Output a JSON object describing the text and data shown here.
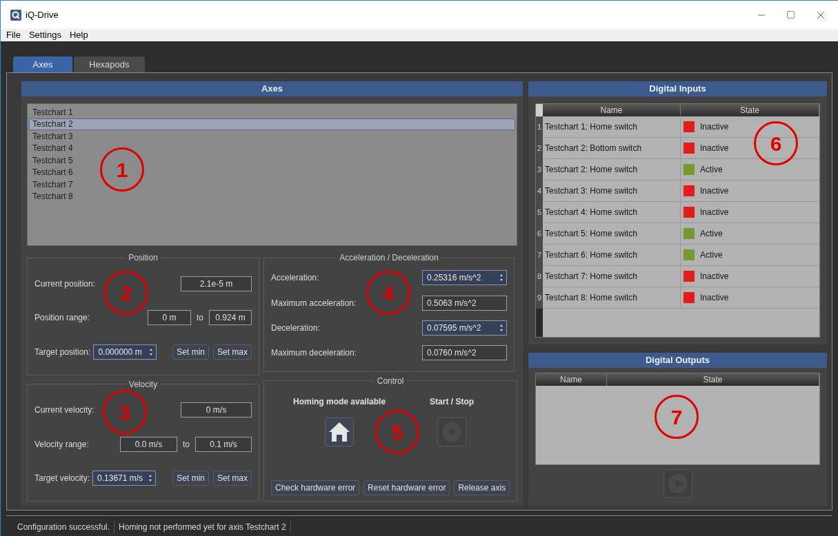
{
  "window": {
    "title": "iQ-Drive"
  },
  "menu": [
    "File",
    "Settings",
    "Help"
  ],
  "tabs": [
    {
      "label": "Axes",
      "selected": true
    },
    {
      "label": "Hexapods",
      "selected": false
    }
  ],
  "axes": {
    "title": "Axes",
    "items": [
      {
        "label": "Testchart 1",
        "selected": false
      },
      {
        "label": "Testchart 2",
        "selected": true
      },
      {
        "label": "Testchart 3",
        "selected": false
      },
      {
        "label": "Testchart 4",
        "selected": false
      },
      {
        "label": "Testchart 5",
        "selected": false
      },
      {
        "label": "Testchart 6",
        "selected": false
      },
      {
        "label": "Testchart 7",
        "selected": false
      },
      {
        "label": "Testchart 8",
        "selected": false
      }
    ]
  },
  "position": {
    "title": "Position",
    "current_label": "Current position:",
    "current": "2.1e-5 m",
    "range_label": "Position range:",
    "range_min": "0 m",
    "range_sep": "to",
    "range_max": "0.924 m",
    "target_label": "Target position:",
    "target": "0.000000 m",
    "buttons": [
      "Set min",
      "Set max"
    ]
  },
  "velocity": {
    "title": "Velocity",
    "current_label": "Current velocity:",
    "current": "0 m/s",
    "range_label": "Velocity range:",
    "range_min": "0.0 m/s",
    "range_sep": "to",
    "range_max": "0.1 m/s",
    "target_label": "Target velocity:",
    "target": "0.13671 m/s",
    "buttons": [
      "Set min",
      "Set max"
    ]
  },
  "acceleration": {
    "title": "Acceleration / Deceleration",
    "fields": [
      {
        "label": "Acceleration:",
        "value": "0.25316 m/s^2",
        "kind": "spin"
      },
      {
        "label": "Maximum acceleration:",
        "value": "0.5063 m/s^2",
        "kind": "readonly"
      },
      {
        "label": "Deceleration:",
        "value": "0.07595 m/s^2",
        "kind": "spin"
      },
      {
        "label": "Maximum deceleration:",
        "value": "0.0760 m/s^2",
        "kind": "readonly"
      }
    ]
  },
  "control": {
    "title": "Control",
    "homing_label": "Homing mode available",
    "start_label": "Start / Stop",
    "start_disabled": true,
    "buttons": [
      "Check hardware error",
      "Reset hardware error",
      "Release axis"
    ]
  },
  "digital_inputs": {
    "title": "Digital Inputs",
    "columns": [
      "Name",
      "State"
    ],
    "rows": [
      {
        "index": "1",
        "name": "Testchart 1: Home switch",
        "state": "Inactive",
        "color": "#e31b1b"
      },
      {
        "index": "2",
        "name": "Testchart 2: Bottom switch",
        "state": "Inactive",
        "color": "#e31b1b"
      },
      {
        "index": "3",
        "name": "Testchart 2: Home switch",
        "state": "Active",
        "color": "#74992e"
      },
      {
        "index": "4",
        "name": "Testchart 3: Home switch",
        "state": "Inactive",
        "color": "#e31b1b"
      },
      {
        "index": "5",
        "name": "Testchart 4: Home switch",
        "state": "Inactive",
        "color": "#e31b1b"
      },
      {
        "index": "6",
        "name": "Testchart 5: Home switch",
        "state": "Active",
        "color": "#74992e"
      },
      {
        "index": "7",
        "name": "Testchart 6: Home switch",
        "state": "Active",
        "color": "#74992e"
      },
      {
        "index": "8",
        "name": "Testchart 7: Home switch",
        "state": "Inactive",
        "color": "#e31b1b"
      },
      {
        "index": "9",
        "name": "Testchart 8: Home switch",
        "state": "Inactive",
        "color": "#e31b1b"
      }
    ]
  },
  "digital_outputs": {
    "title": "Digital Outputs",
    "columns": [
      "Name",
      "State"
    ],
    "play_disabled": true
  },
  "status_bar": [
    "Configuration successful.",
    "Homing not performed yet for axis Testchart 2"
  ],
  "callouts": [
    "1",
    "2",
    "3",
    "4",
    "5",
    "6",
    "7"
  ]
}
